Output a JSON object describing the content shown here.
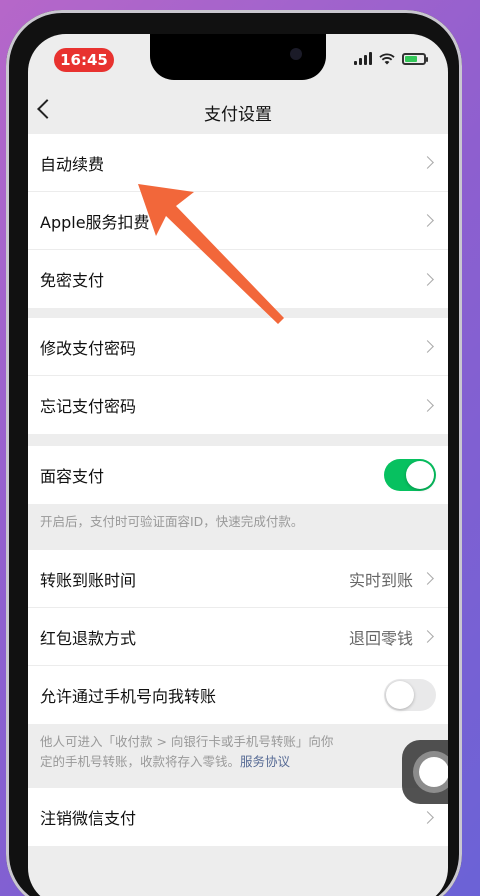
{
  "status": {
    "time": "16:45"
  },
  "nav": {
    "title": "支付设置"
  },
  "group1": [
    {
      "label": "自动续费"
    },
    {
      "label": "Apple服务扣费"
    },
    {
      "label": "免密支付"
    }
  ],
  "group2": [
    {
      "label": "修改支付密码"
    },
    {
      "label": "忘记支付密码"
    }
  ],
  "face_pay": {
    "label": "面容支付",
    "enabled": true,
    "note": "开启后，支付时可验证面容ID，快速完成付款。"
  },
  "group4": [
    {
      "label": "转账到账时间",
      "value": "实时到账"
    },
    {
      "label": "红包退款方式",
      "value": "退回零钱"
    }
  ],
  "phone_transfer": {
    "label": "允许通过手机号向我转账",
    "enabled": false,
    "note_line1": "他人可进入「收付款 > 向银行卡或手机号转账」向你",
    "note_line2": "定的手机号转账，收款将存入零钱。",
    "note_link": "服务协议"
  },
  "group6": [
    {
      "label": "注销微信支付"
    }
  ],
  "colors": {
    "toggle_on": "#07c160",
    "status_time_bg": "#e8322f",
    "link": "#576b95",
    "arrow": "#f2673a"
  }
}
